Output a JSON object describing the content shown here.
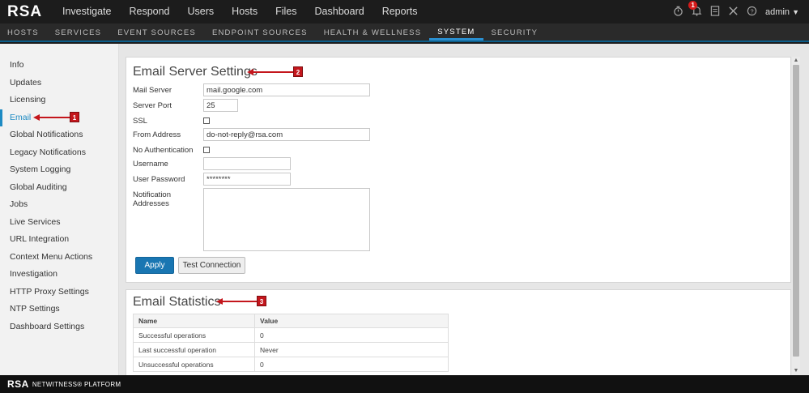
{
  "app": {
    "logo": "RSA"
  },
  "top_nav": [
    {
      "label": "Investigate"
    },
    {
      "label": "Respond"
    },
    {
      "label": "Users"
    },
    {
      "label": "Hosts"
    },
    {
      "label": "Files"
    },
    {
      "label": "Dashboard"
    },
    {
      "label": "Reports"
    }
  ],
  "top_right": {
    "notification_count": "1",
    "user": "admin"
  },
  "sub_nav": [
    {
      "label": "HOSTS"
    },
    {
      "label": "SERVICES"
    },
    {
      "label": "EVENT SOURCES"
    },
    {
      "label": "ENDPOINT SOURCES"
    },
    {
      "label": "HEALTH & WELLNESS"
    },
    {
      "label": "SYSTEM",
      "active": true
    },
    {
      "label": "SECURITY"
    }
  ],
  "sidebar": {
    "items": [
      {
        "label": "Info"
      },
      {
        "label": "Updates"
      },
      {
        "label": "Licensing"
      },
      {
        "label": "Email",
        "active": true
      },
      {
        "label": "Global Notifications"
      },
      {
        "label": "Legacy Notifications"
      },
      {
        "label": "System Logging"
      },
      {
        "label": "Global Auditing"
      },
      {
        "label": "Jobs"
      },
      {
        "label": "Live Services"
      },
      {
        "label": "URL Integration"
      },
      {
        "label": "Context Menu Actions"
      },
      {
        "label": "Investigation"
      },
      {
        "label": "HTTP Proxy Settings"
      },
      {
        "label": "NTP Settings"
      },
      {
        "label": "Dashboard Settings"
      }
    ]
  },
  "email_settings": {
    "title": "Email Server Settings",
    "mail_server_label": "Mail Server",
    "mail_server_value": "mail.google.com",
    "server_port_label": "Server Port",
    "server_port_value": "25",
    "ssl_label": "SSL",
    "ssl_checked": false,
    "from_address_label": "From Address",
    "from_address_value": "do-not-reply@rsa.com",
    "no_auth_label": "No Authentication",
    "no_auth_checked": false,
    "username_label": "Username",
    "username_value": "",
    "password_label": "User Password",
    "password_value": "********",
    "notification_label_line1": "Notification",
    "notification_label_line2": "Addresses",
    "notification_value": "",
    "apply_label": "Apply",
    "test_label": "Test Connection"
  },
  "email_stats": {
    "title": "Email Statistics",
    "headers": {
      "name": "Name",
      "value": "Value"
    },
    "rows": [
      {
        "name": "Successful operations",
        "value": "0"
      },
      {
        "name": "Last successful operation",
        "value": "Never"
      },
      {
        "name": "Unsuccessful operations",
        "value": "0"
      }
    ]
  },
  "callouts": {
    "one": "1",
    "two": "2",
    "three": "3"
  },
  "colors": {
    "accent": "#1e8bc3",
    "primary_button": "#1976b2",
    "callout": "#c4161c"
  },
  "footer": {
    "logo": "RSA",
    "text": "NETWITNESS® PLATFORM"
  }
}
